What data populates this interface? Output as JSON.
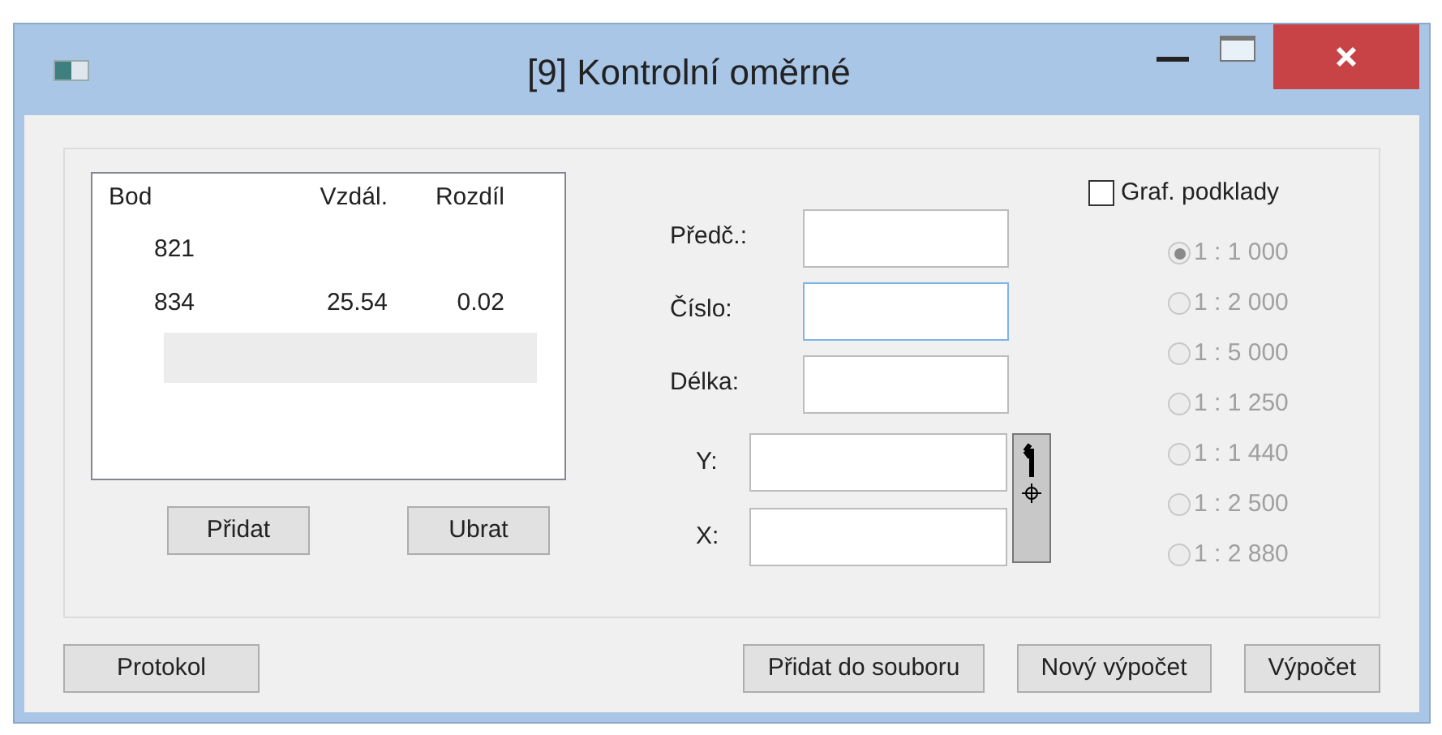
{
  "window": {
    "title": "[9] Kontrolní oměrné"
  },
  "list": {
    "columns": [
      "Bod",
      "Vzdál.",
      "Rozdíl"
    ],
    "rows": [
      {
        "cells": [
          "821",
          "",
          ""
        ],
        "selected": false
      },
      {
        "cells": [
          "834",
          "25.54",
          "0.02"
        ],
        "selected": false
      },
      {
        "cells": [
          "",
          "",
          ""
        ],
        "selected": true
      }
    ]
  },
  "list_buttons": [
    "Přidat",
    "Ubrat"
  ],
  "fields": [
    {
      "label": "Předč.:",
      "focused": false
    },
    {
      "label": "Číslo:",
      "focused": true
    },
    {
      "label": "Délka:",
      "focused": false
    }
  ],
  "coords": [
    {
      "label": "Y:"
    },
    {
      "label": "X:"
    }
  ],
  "graf": {
    "label": "Graf. podklady",
    "checked": false
  },
  "scales": [
    {
      "label": "1 : 1 000",
      "selected": true,
      "disabled": true
    },
    {
      "label": "1 : 2 000",
      "selected": false,
      "disabled": true
    },
    {
      "label": "1 : 5 000",
      "selected": false,
      "disabled": true
    },
    {
      "label": "1 : 1 250",
      "selected": false,
      "disabled": true
    },
    {
      "label": "1 : 1 440",
      "selected": false,
      "disabled": true
    },
    {
      "label": "1 : 2 500",
      "selected": false,
      "disabled": true
    },
    {
      "label": "1 : 2 880",
      "selected": false,
      "disabled": true
    }
  ],
  "bottom_left_buttons": [
    "Protokol"
  ],
  "bottom_right_buttons": [
    "Přidat do souboru",
    "Nový výpočet",
    "Výpočet"
  ]
}
